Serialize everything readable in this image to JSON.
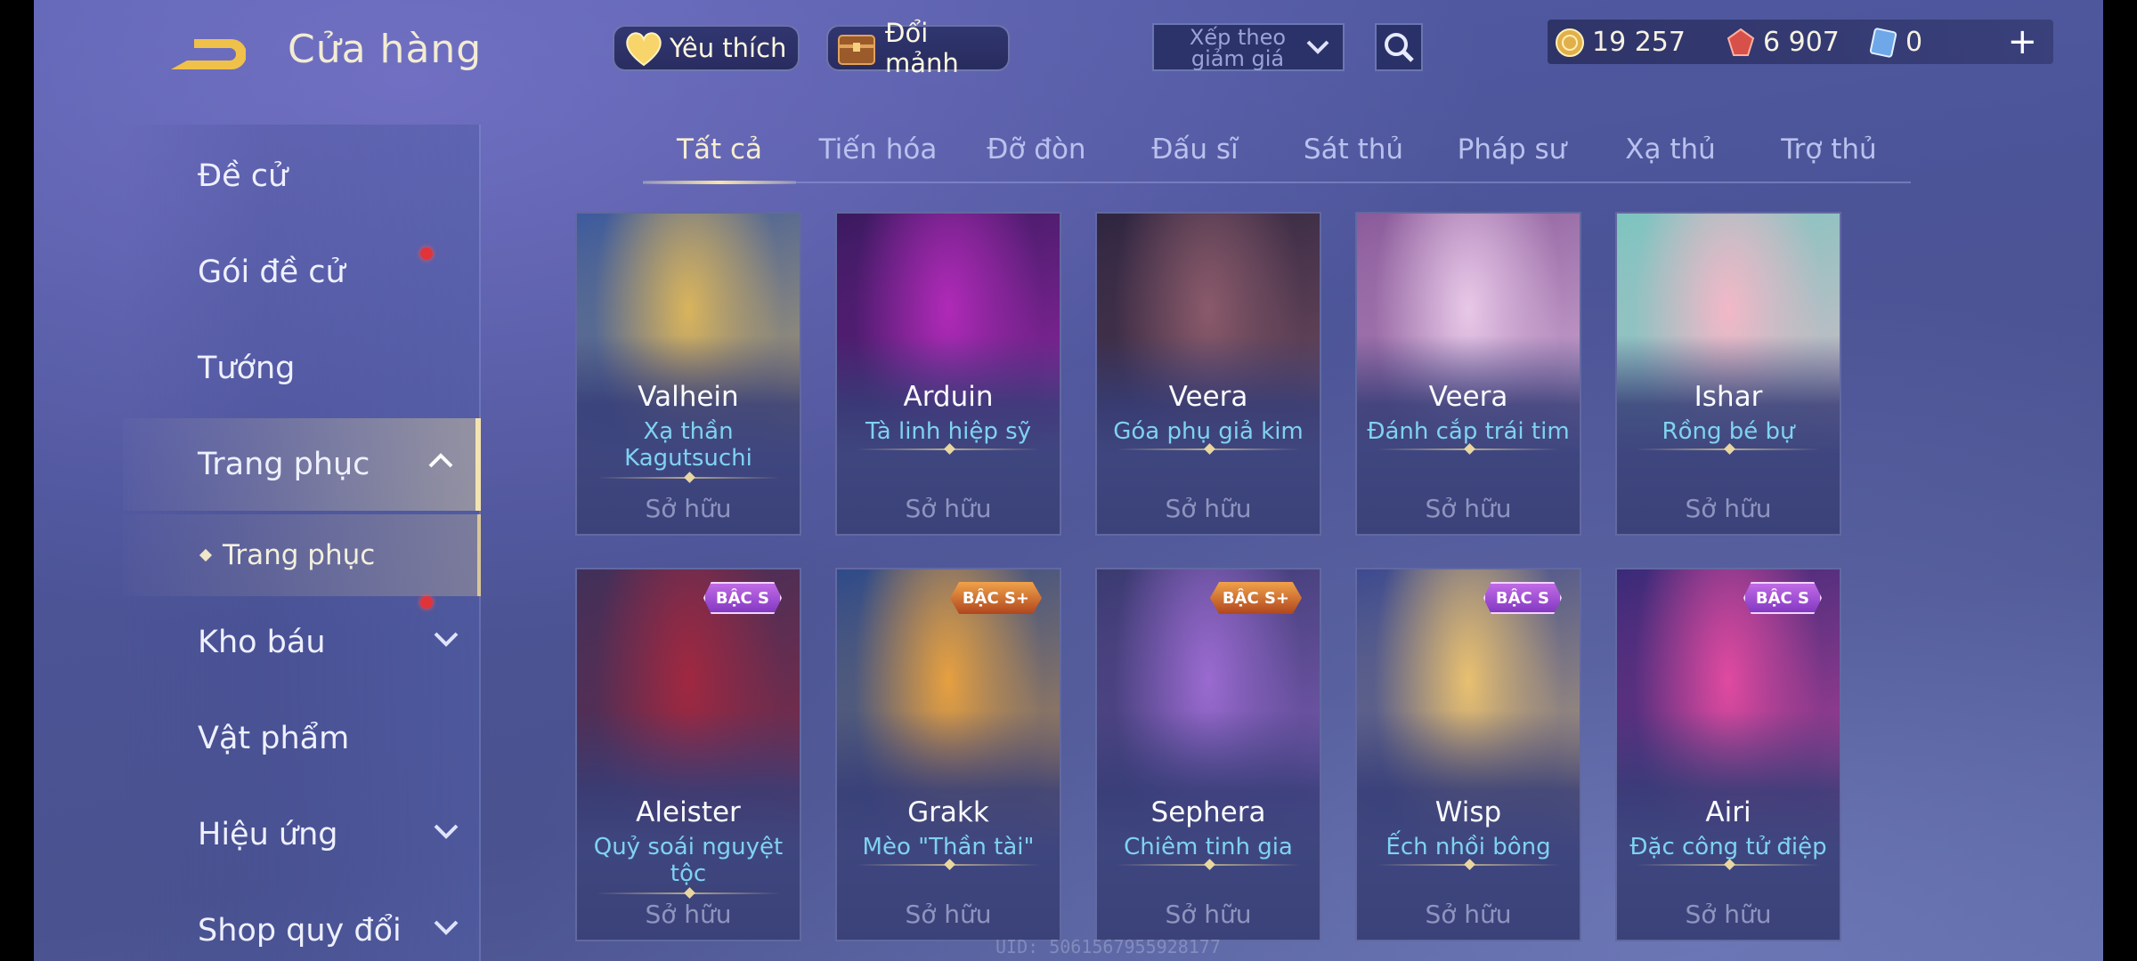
{
  "header": {
    "title": "Cửa hàng",
    "favorites_label": "Yêu thích",
    "fragments_label": "Đổi mảnh",
    "sort_label": "Xếp theo giảm giá",
    "currencies": [
      {
        "icon": "gold-coin-icon",
        "value": "19 257"
      },
      {
        "icon": "red-gem-icon",
        "value": "6 907"
      },
      {
        "icon": "voucher-icon",
        "value": "0"
      }
    ],
    "plus_label": "+"
  },
  "sidebar": {
    "items": [
      {
        "label": "Đề cử"
      },
      {
        "label": "Gói đề cử"
      },
      {
        "label": "Tướng"
      },
      {
        "label": "Trang phục"
      },
      {
        "label": "Kho báu"
      },
      {
        "label": "Vật phẩm"
      },
      {
        "label": "Hiệu ứng"
      },
      {
        "label": "Shop quy đổi"
      }
    ],
    "sub_item": "Trang phục"
  },
  "tabs": [
    "Tất cả",
    "Tiến hóa",
    "Đỡ đòn",
    "Đấu sĩ",
    "Sát thủ",
    "Pháp sư",
    "Xạ thủ",
    "Trợ thủ"
  ],
  "active_tab": "Tất cả",
  "cards": [
    {
      "hero": "Valhein",
      "skin": "Xạ thần Kagutsuchi",
      "status": "Sở hữu",
      "badge": "",
      "colors": [
        "#d9b45c",
        "#3c5a9e"
      ]
    },
    {
      "hero": "Arduin",
      "skin": "Tà linh hiệp sỹ",
      "status": "Sở hữu",
      "badge": "",
      "colors": [
        "#b02ab8",
        "#3a1a60"
      ]
    },
    {
      "hero": "Veera",
      "skin": "Góa phụ giả kim",
      "status": "Sở hữu",
      "badge": "",
      "colors": [
        "#8a5a6a",
        "#2e2540"
      ]
    },
    {
      "hero": "Veera",
      "skin": "Đánh cắp trái tim",
      "status": "Sở hữu",
      "badge": "",
      "colors": [
        "#e8c8e8",
        "#8a5a9a"
      ]
    },
    {
      "hero": "Ishar",
      "skin": "Rồng bé bự",
      "status": "Sở hữu",
      "badge": "",
      "colors": [
        "#f2b8c8",
        "#7cc4c0"
      ]
    },
    {
      "hero": "Aleister",
      "skin": "Quỷ soái nguyệt tộc",
      "status": "Sở hữu",
      "badge": "BẬC S",
      "colors": [
        "#a02840",
        "#40305a"
      ]
    },
    {
      "hero": "Grakk",
      "skin": "Mèo \"Thần tài\"",
      "status": "Sở hữu",
      "badge": "BẬC S+",
      "colors": [
        "#e6a040",
        "#2e4a8a"
      ]
    },
    {
      "hero": "Sephera",
      "skin": "Chiêm tinh gia",
      "status": "Sở hữu",
      "badge": "BẬC S+",
      "colors": [
        "#9a6ad0",
        "#3a3a70"
      ]
    },
    {
      "hero": "Wisp",
      "skin": "Ếch nhồi bông",
      "status": "Sở hữu",
      "badge": "BẬC S",
      "colors": [
        "#e8c070",
        "#3c4a90"
      ]
    },
    {
      "hero": "Airi",
      "skin": "Đặc công tử điệp",
      "status": "Sở hữu",
      "badge": "BẬC S",
      "colors": [
        "#e04aa0",
        "#3a2a78"
      ]
    }
  ],
  "uid": "UID: 5061567955928177"
}
